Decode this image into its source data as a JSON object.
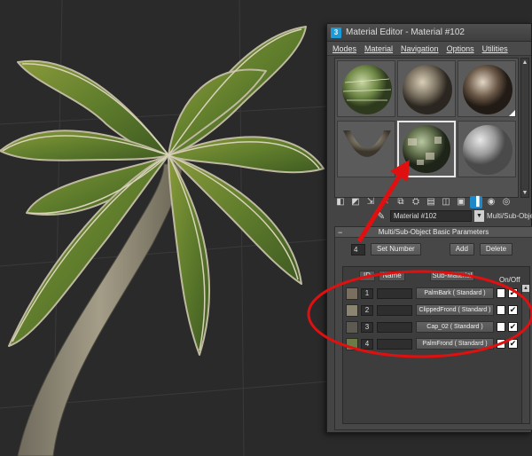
{
  "editor": {
    "title": "Material Editor - Material #102",
    "menu": [
      "Modes",
      "Material",
      "Navigation",
      "Options",
      "Utilities"
    ]
  },
  "material_name": "Material #102",
  "material_type": "Multi/Sub-Object",
  "rollout_title": "Multi/Sub-Object Basic Parameters",
  "set_number_value": "4",
  "buttons": {
    "set_number": "Set Number",
    "add": "Add",
    "delete": "Delete"
  },
  "columns": {
    "id": "ID",
    "name": "Name",
    "sub_material": "Sub-Material",
    "on_off": "On/Off"
  },
  "rows": [
    {
      "id": "1",
      "sub_material": "PalmBark ( Standard )",
      "checked": true
    },
    {
      "id": "2",
      "sub_material": "ClippedFrond ( Standard )",
      "checked": true
    },
    {
      "id": "3",
      "sub_material": "Cap_02 ( Standard )",
      "checked": true
    },
    {
      "id": "4",
      "sub_material": "PalmFrond ( Standard )",
      "checked": true
    }
  ],
  "icons": {
    "app": "3ds-max-icon",
    "picker": "eyedropper-icon",
    "toolbar": [
      "get-material-icon",
      "put-to-scene-icon",
      "assign-icon",
      "reset-icon",
      "copy-icon",
      "unique-icon",
      "put-library-icon",
      "material-id-icon",
      "show-map-icon",
      "show-end-icon",
      "go-parent-icon",
      "go-forward-icon",
      "pick-icon"
    ]
  },
  "colors": {
    "annotation": "#e01010",
    "active_tool": "#1e88c8",
    "panel": "#444444"
  }
}
